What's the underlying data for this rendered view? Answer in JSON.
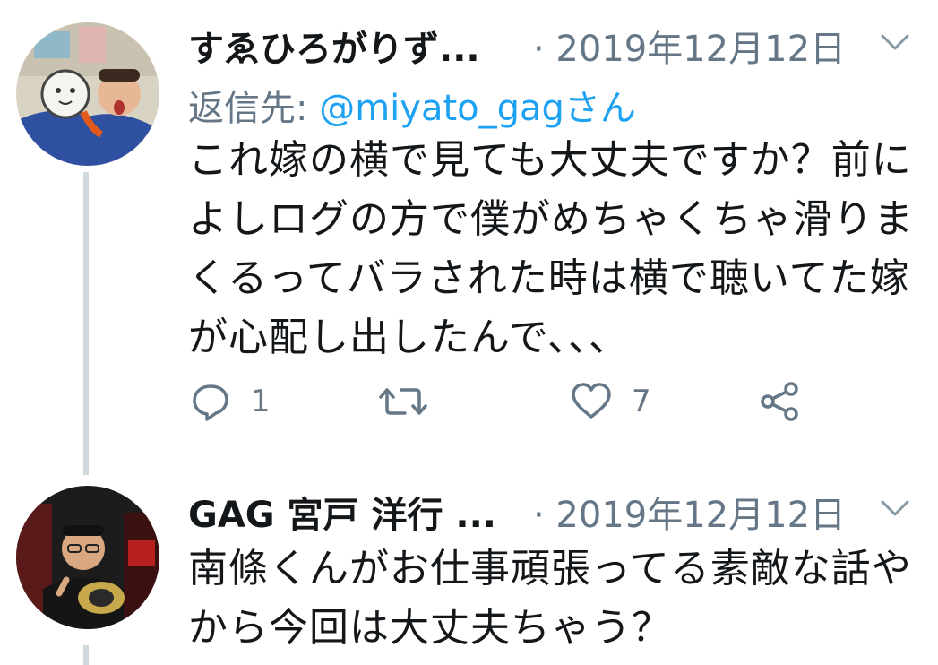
{
  "tweets": [
    {
      "author_name": "すゑひろがりず...",
      "date": "· 2019年12月12日",
      "reply_prefix": "返信先: ",
      "reply_handle": "@miyato_gagさん",
      "body_lines": [
        "これ嫁の横で見ても大丈夫ですか？前に",
        "よしログの方で僕がめちゃくちゃ滑りま",
        "くるってバラされた時は横で聴いてた嫁",
        "が心配し出したんで、、、"
      ],
      "reply_count": "1",
      "like_count": "7"
    },
    {
      "author_name": "GAG 宮戸 洋行 ...",
      "date": "· 2019年12月12日",
      "body_lines": [
        "南條くんがお仕事頑張ってる素敵な話や",
        "から今回は大丈夫ちゃう？"
      ]
    }
  ],
  "icons": {
    "reply": "reply-icon",
    "retweet": "retweet-icon",
    "like": "heart-icon",
    "share": "share-icon",
    "caret": "chevron-down-icon"
  },
  "colors": {
    "text": "#14171a",
    "secondary": "#657786",
    "link": "#1da1f2",
    "thread_line": "#cfd9de"
  }
}
